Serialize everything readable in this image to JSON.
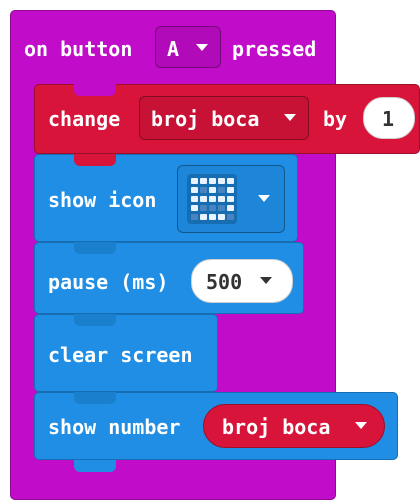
{
  "event": {
    "prefix": "on button",
    "button_value": "A",
    "suffix": "pressed"
  },
  "change_block": {
    "keyword": "change",
    "variable": "broj boca",
    "by_label": "by",
    "amount": "1"
  },
  "show_icon_block": {
    "label": "show icon",
    "icon": "icon-pattern"
  },
  "pause_block": {
    "label": "pause (ms)",
    "value": "500"
  },
  "clear_block": {
    "label": "clear screen"
  },
  "show_number_block": {
    "label": "show number",
    "variable": "broj boca"
  },
  "colors": {
    "event": "#c10cc9",
    "variables": "#d8143a",
    "basic": "#1f8ee4"
  }
}
